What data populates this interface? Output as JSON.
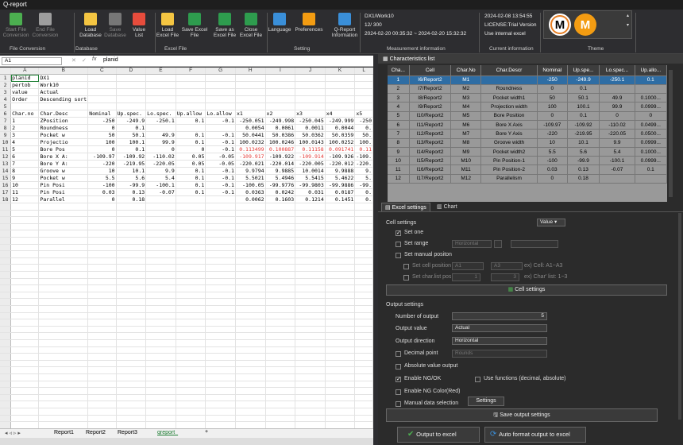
{
  "title": "Q-report",
  "ribbon": {
    "buttons": [
      {
        "label": "Start File Conversion",
        "icon": "play-icon",
        "color": "#4caf50",
        "disabled": true
      },
      {
        "label": "End File Conversion",
        "icon": "stop-icon",
        "color": "#9e9e9e",
        "disabled": true
      },
      {
        "label": "Load Database",
        "icon": "database-load-icon",
        "color": "#f4c542",
        "disabled": false
      },
      {
        "label": "Save Database",
        "icon": "database-save-icon",
        "color": "#777",
        "disabled": true
      },
      {
        "label": "Value List",
        "icon": "chart-icon",
        "color": "#e74c3c",
        "disabled": false
      },
      {
        "label": "Load Excel File",
        "icon": "folder-icon",
        "color": "#f4c542",
        "disabled": false
      },
      {
        "label": "Save Excel File",
        "icon": "save-excel-icon",
        "color": "#2e9c4e",
        "disabled": false
      },
      {
        "label": "Save as Excel File",
        "icon": "save-as-excel-icon",
        "color": "#2e9c4e",
        "disabled": false
      },
      {
        "label": "Close Excel File",
        "icon": "close-excel-icon",
        "color": "#2e9c4e",
        "disabled": false
      },
      {
        "label": "Language",
        "icon": "globe-icon",
        "color": "#3a8fd9",
        "disabled": false
      },
      {
        "label": "Preferences",
        "icon": "gear-icon",
        "color": "#f39c12",
        "disabled": false
      },
      {
        "label": "Q-Report Information",
        "icon": "info-icon",
        "color": "#3a8fd9",
        "disabled": false
      }
    ],
    "groups": [
      "File Conversion",
      "Database",
      "Excel File",
      "Setting",
      "Measurement information",
      "Current information",
      "Theme"
    ],
    "measurement": {
      "line1": "DX1/Work10",
      "line2": "12/ 300",
      "line3": "2024-02-20 00:35:32 ~ 2024-02-20 15:32:32"
    },
    "current": {
      "line1": "2024-02-08 13:54:55",
      "line2": "LICENSE:Trial Version",
      "line3": "Use internal excel"
    }
  },
  "formula_bar": {
    "cell": "A1",
    "value": "planid"
  },
  "sheet": {
    "columns": [
      "",
      "A",
      "B",
      "C",
      "D",
      "E",
      "F",
      "G",
      "H",
      "I",
      "J",
      "K",
      "L"
    ],
    "rows": [
      [
        "1",
        "planid",
        "DX1",
        "",
        "",
        "",
        "",
        "",
        "",
        "",
        "",
        "",
        ""
      ],
      [
        "2",
        "pertob",
        "Work10",
        "",
        "",
        "",
        "",
        "",
        "",
        "",
        "",
        "",
        ""
      ],
      [
        "3",
        "value",
        "Actual",
        "",
        "",
        "",
        "",
        "",
        "",
        "",
        "",
        "",
        ""
      ],
      [
        "4",
        "Order",
        "Descending sort",
        "",
        "",
        "",
        "",
        "",
        "",
        "",
        "",
        "",
        ""
      ],
      [
        "5",
        "",
        "",
        "",
        "",
        "",
        "",
        "",
        "",
        "",
        "",
        "",
        ""
      ],
      [
        "6",
        "Char.no",
        "Char.Desc",
        "Nominal",
        "Up.spec.",
        "Lo.spec.",
        "Up.allow",
        "Lo.allow",
        "x1",
        "x2",
        "x3",
        "x4",
        "x5"
      ],
      [
        "7",
        "1",
        "ZPosition",
        "-250",
        "-249.9",
        "-250.1",
        "0.1",
        "-0.1",
        "-250.051",
        "-249.998",
        "-250.045",
        "-249.999",
        "-250"
      ],
      [
        "8",
        "2",
        "Roundness",
        "0",
        "0.1",
        "",
        "",
        "",
        "0.0054",
        "0.0061",
        "0.0011",
        "0.0044",
        "0."
      ],
      [
        "9",
        "3",
        "Pocket w",
        "50",
        "50.1",
        "49.9",
        "0.1",
        "-0.1",
        "50.0441",
        "50.0386",
        "50.0362",
        "50.0359",
        "50."
      ],
      [
        "10",
        "4",
        "Projectio",
        "100",
        "100.1",
        "99.9",
        "0.1",
        "-0.1",
        "100.0232",
        "100.0246",
        "100.0143",
        "100.0252",
        "100."
      ],
      [
        "11",
        "5",
        "Bore Pos",
        "0",
        "0.1",
        "0",
        "0",
        "-0.1",
        "0.113499",
        "0.100887",
        "0.11158",
        "0.091741",
        "0.11"
      ],
      [
        "12",
        "6",
        "Bore X A:",
        "-109.97",
        "-109.92",
        "-110.02",
        "0.05",
        "-0.05",
        "-109.917",
        "-109.922",
        "-109.914",
        "-109.926",
        "-109."
      ],
      [
        "13",
        "7",
        "Bore Y A:",
        "-220",
        "-219.95",
        "-220.05",
        "0.05",
        "-0.05",
        "-220.021",
        "-220.014",
        "-220.005",
        "-220.012",
        "-220."
      ],
      [
        "14",
        "8",
        "Groove w",
        "10",
        "10.1",
        "9.9",
        "0.1",
        "-0.1",
        "9.9794",
        "9.9885",
        "10.0014",
        "9.9888",
        "9."
      ],
      [
        "15",
        "9",
        "Pocket w",
        "5.5",
        "5.6",
        "5.4",
        "0.1",
        "-0.1",
        "5.5021",
        "5.4946",
        "5.5415",
        "5.4622",
        "5."
      ],
      [
        "16",
        "10",
        "Pin Posi",
        "-100",
        "-99.9",
        "-100.1",
        "0.1",
        "-0.1",
        "-100.05",
        "-99.9776",
        "-99.9803",
        "-99.9886",
        "-99."
      ],
      [
        "17",
        "11",
        "Pin Posi",
        "0.03",
        "0.13",
        "-0.07",
        "0.1",
        "-0.1",
        "0.0363",
        "0.0242",
        "0.031",
        "0.0187",
        "0."
      ],
      [
        "18",
        "12",
        "Parallel",
        "0",
        "0.18",
        "",
        "",
        "",
        "0.0062",
        "0.1603",
        "0.1214",
        "0.1451",
        "0."
      ]
    ],
    "tabs": [
      "Report1",
      "Report2",
      "Report3",
      "qreport_"
    ]
  },
  "char_list": {
    "title": "Characteristics list",
    "headers": [
      "Cha...",
      "Cell",
      "Char.No",
      "Char.Descr",
      "Nominal",
      "Up.spe...",
      "Lo.spec...",
      "Up.allo..."
    ],
    "rows": [
      [
        "1",
        "I6/Report2",
        "M1",
        "",
        "-250",
        "-249.9",
        "-250.1",
        "0.1"
      ],
      [
        "2",
        "I7/Report2",
        "M2",
        "Roundness",
        "0",
        "0.1",
        "",
        ""
      ],
      [
        "3",
        "I8/Report2",
        "M3",
        "Pocket width1",
        "50",
        "50.1",
        "49.9",
        "0.1000..."
      ],
      [
        "4",
        "I9/Report2",
        "M4",
        "Projection width",
        "100",
        "100.1",
        "99.9",
        "0.0999..."
      ],
      [
        "5",
        "I10/Report2",
        "M5",
        "Bore Position",
        "0",
        "0.1",
        "0",
        "0"
      ],
      [
        "6",
        "I11/Report2",
        "M6",
        "Bore X Axis",
        "-109.97",
        "-109.92",
        "-110.02",
        "0.0499..."
      ],
      [
        "7",
        "I12/Report2",
        "M7",
        "Bore Y Axis",
        "-220",
        "-219.95",
        "-220.05",
        "0.0500..."
      ],
      [
        "8",
        "I13/Report2",
        "M8",
        "Groove width",
        "10",
        "10.1",
        "9.9",
        "0.0999..."
      ],
      [
        "9",
        "I14/Report2",
        "M9",
        "Pocket width2",
        "5.5",
        "5.6",
        "5.4",
        "0.1000..."
      ],
      [
        "10",
        "I15/Report2",
        "M10",
        "Pin Position-1",
        "-100",
        "-99.9",
        "-100.1",
        "0.0999..."
      ],
      [
        "11",
        "I16/Report2",
        "M11",
        "Pin Position-2",
        "0.03",
        "0.13",
        "-0.07",
        "0.1"
      ],
      [
        "12",
        "I17/Report2",
        "M12",
        "Parallelism",
        "0",
        "0.18",
        "",
        ""
      ]
    ]
  },
  "settings": {
    "tab_excel": "Excel settings",
    "tab_chart": "Chart",
    "cell_settings": "Cell settings",
    "cell_value": "Value",
    "set_one": "Set one",
    "set_range": "Set range",
    "range_dir": "Horizontal",
    "set_manual": "Set manual positon",
    "set_cell_pos": "Set cell position",
    "cell_a": "A1",
    "cell_b": "A3",
    "cell_ex": "ex) Cell: A1~A3",
    "set_char_pos": "Set char.list pos",
    "pos_a": "1",
    "pos_b": "3",
    "pos_ex": "ex) Char' list: 1~3",
    "cell_settings_btn": "Cell settings",
    "output_settings": "Output settings",
    "num_output_label": "Number of output",
    "num_output": "5",
    "output_value_label": "Output value",
    "output_value": "Actual",
    "output_dir_label": "Output direction",
    "output_dir": "Horizontal",
    "decimal_label": "Decimal point",
    "decimal": "Rounds",
    "abs_label": "Absolute value output",
    "ng_ok": "Enable NG/OK",
    "use_fn": "Use functions (decimal, absolute)",
    "ng_color": "Enable NG Color(Red)",
    "manual_sel": "Manual data selection",
    "settings_btn": "Settings",
    "save_out": "Save output settings",
    "out_excel": "Output to excel",
    "auto_fmt": "Auto format output to excel"
  }
}
